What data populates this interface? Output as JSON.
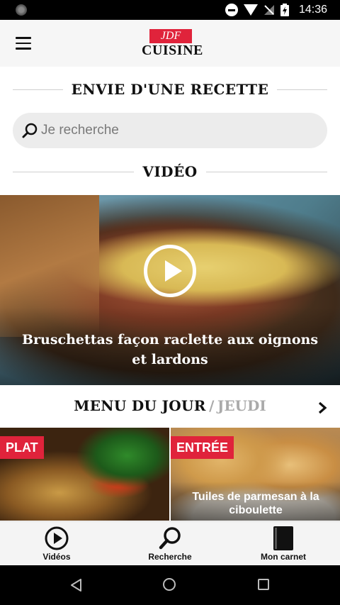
{
  "status_bar": {
    "time": "14:36",
    "icons": [
      "camera-dot-icon",
      "do-not-disturb-icon",
      "wifi-icon",
      "no-signal-icon",
      "battery-charging-icon"
    ]
  },
  "header": {
    "menu_icon": "hamburger-icon",
    "logo_top": "JDF",
    "logo_bottom": "CUISINE",
    "brand_color": "#e0233b"
  },
  "search_section": {
    "title": "ENVIE D'UNE RECETTE",
    "placeholder": "Je recherche",
    "icon": "search-icon"
  },
  "video_section": {
    "title": "VIDÉO",
    "featured": {
      "title": "Bruschettas façon raclette aux oignons et lardons",
      "icon": "play-icon"
    }
  },
  "menu_du_jour": {
    "label": "MENU DU JOUR",
    "separator": "/",
    "day": "JEUDI",
    "next_icon": "chevron-right-icon",
    "cards": [
      {
        "tag": "PLAT",
        "title": ""
      },
      {
        "tag": "ENTRÉE",
        "title": "Tuiles de parmesan à la ciboulette"
      }
    ]
  },
  "bottom_nav": {
    "items": [
      {
        "label": "Vidéos",
        "icon": "play-circle-icon"
      },
      {
        "label": "Recherche",
        "icon": "search-icon"
      },
      {
        "label": "Mon carnet",
        "icon": "notebook-icon"
      }
    ]
  },
  "system_nav": {
    "icons": [
      "back-icon",
      "home-icon",
      "recents-icon"
    ]
  }
}
